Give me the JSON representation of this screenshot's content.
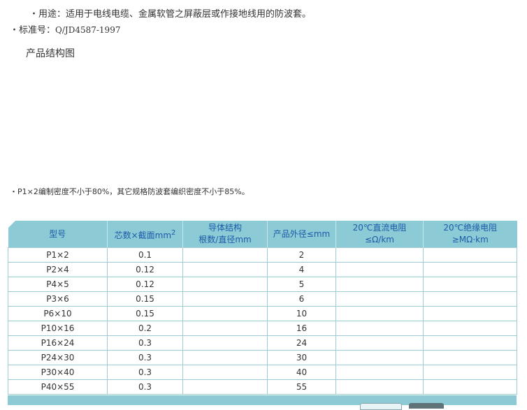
{
  "usage": "・用途：适用于电线电缆、金属软管之屏蔽层或作接地线用的防波套。",
  "standard": {
    "label": "・标准号：",
    "code": "Q/JD4587-1997"
  },
  "structure_heading": "产品结构图",
  "note": "・P1×2编制密度不小于80%，其它规格防波套编织密度不小于85%。",
  "table": {
    "headers": [
      {
        "line1": "型号",
        "line2": ""
      },
      {
        "line1": "芯数×截面mm",
        "sup": "2",
        "line2": ""
      },
      {
        "line1": "导体结构",
        "line2": "根数/直径mm"
      },
      {
        "line1": "产品外径≤mm",
        "line2": ""
      },
      {
        "line1": "20℃直流电阻≤Ω/km",
        "line2": ""
      },
      {
        "line1": "20℃绝缘电阻",
        "line2": "≥MΩ·km"
      }
    ],
    "rows": [
      [
        "P1×2",
        "0.1",
        "",
        "2",
        "",
        ""
      ],
      [
        "P2×4",
        "0.12",
        "",
        "4",
        "",
        ""
      ],
      [
        "P4×5",
        "0.12",
        "",
        "5",
        "",
        ""
      ],
      [
        "P3×6",
        "0.15",
        "",
        "6",
        "",
        ""
      ],
      [
        "P6×10",
        "0.15",
        "",
        "10",
        "",
        ""
      ],
      [
        "P10×16",
        "0.2",
        "",
        "16",
        "",
        ""
      ],
      [
        "P16×24",
        "0.3",
        "",
        "24",
        "",
        ""
      ],
      [
        "P24×30",
        "0.3",
        "",
        "30",
        "",
        ""
      ],
      [
        "P30×40",
        "0.3",
        "",
        "40",
        "",
        ""
      ],
      [
        "P40×55",
        "0.3",
        "",
        "55",
        "",
        ""
      ]
    ]
  },
  "colors": {
    "header_bg": "#8ccbd6",
    "header_text": "#1e5aa8",
    "grid": "#9dcbd4"
  }
}
